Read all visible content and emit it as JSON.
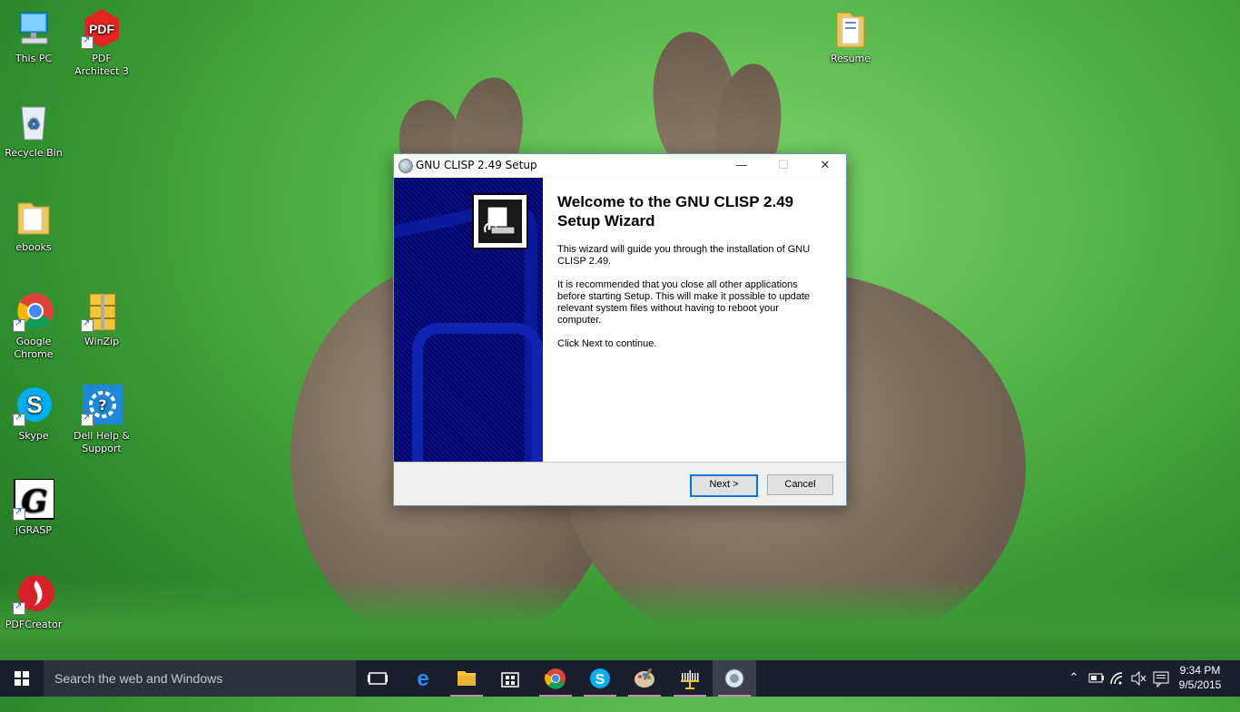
{
  "desktop": {
    "icons": [
      {
        "label": "This PC"
      },
      {
        "label": "PDF Architect 3"
      },
      {
        "label": "Recycle Bin"
      },
      {
        "label": "ebooks"
      },
      {
        "label": "Google Chrome"
      },
      {
        "label": "WinZip"
      },
      {
        "label": "Skype"
      },
      {
        "label": "Dell Help & Support"
      },
      {
        "label": "jGRASP"
      },
      {
        "label": "PDFCreator"
      },
      {
        "label": "Resume"
      }
    ],
    "pdf_badge": "PDF",
    "jgrasp_badge": "G"
  },
  "window": {
    "title": "GNU CLISP 2.49 Setup",
    "heading": "Welcome to the GNU CLISP 2.49 Setup Wizard",
    "para1": "This wizard will guide you through the installation of GNU CLISP 2.49.",
    "para2": "It is recommended that you close all other applications before starting Setup. This will make it possible to update relevant system files without having to reboot your computer.",
    "para3": "Click Next to continue.",
    "next_label": "Next >",
    "cancel_label": "Cancel",
    "minimize": "—",
    "maximize": "☐",
    "close": "✕"
  },
  "taskbar": {
    "search_placeholder": "Search the web and Windows",
    "pinned": [
      "task-view-icon",
      "edge-icon",
      "file-explorer-icon",
      "store-icon",
      "chrome-icon",
      "skype-icon",
      "paint-icon",
      "menorah-icon",
      "clisp-setup-icon"
    ],
    "time": "9:34 PM",
    "date": "9/5/2015",
    "accent": "#c886c4"
  }
}
